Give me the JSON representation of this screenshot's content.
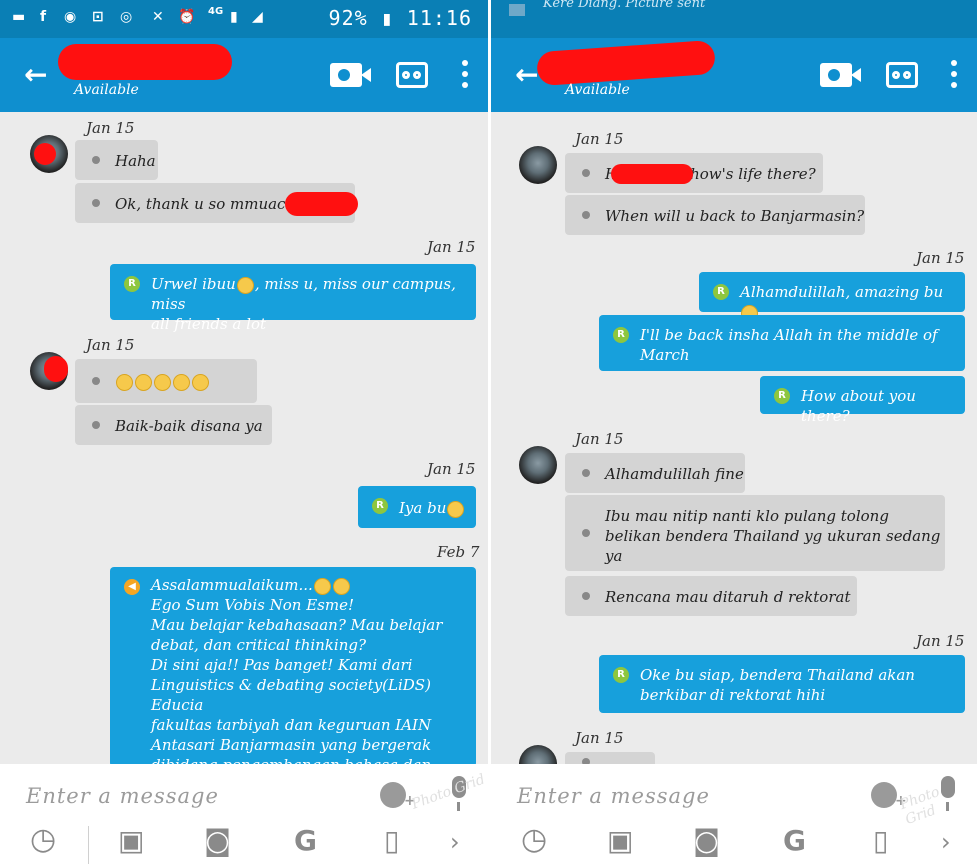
{
  "left": {
    "status_bar": {
      "battery": "92%",
      "time": "11:16",
      "network": "4G"
    },
    "contact_status": "Available",
    "messages": [
      {
        "type": "date",
        "text": "Jan 15"
      },
      {
        "type": "in",
        "text": "Haha"
      },
      {
        "type": "in",
        "text": "Ok, thank u so mmuach"
      },
      {
        "type": "date",
        "text": "Jan 15"
      },
      {
        "type": "out",
        "line1": "Urwel ibuu",
        "line1b": ", miss u, miss our campus, miss",
        "line2": "all friends a lot"
      },
      {
        "type": "date",
        "text": "Jan 15"
      },
      {
        "type": "in",
        "text": ""
      },
      {
        "type": "in",
        "text": "Baik-baik disana ya"
      },
      {
        "type": "date",
        "text": "Jan 15"
      },
      {
        "type": "out",
        "text": "Iya bu"
      },
      {
        "type": "date",
        "text": "Feb 7"
      },
      {
        "type": "broadcast",
        "lines": [
          "Assalammualaikum...",
          "Ego Sum Vobis Non Esme!",
          "Mau belajar kebahasaan? Mau belajar",
          "debat, dan critical thinking?",
          "Di sini aja!! Pas banget! Kami dari",
          "Linguistics & debating society(LiDS) Educia",
          "fakultas tarbiyah dan keguruan IAIN",
          "Antasari Banjarmasin yang bergerak",
          "dibidang pengembangan bahasa dan"
        ]
      }
    ]
  },
  "right": {
    "notification_preview": "Kere Diang. Picture sent",
    "contact_status": "Available",
    "messages": [
      {
        "type": "date",
        "text": "Jan 15"
      },
      {
        "type": "in",
        "pre": "H",
        "post": "how's life there?"
      },
      {
        "type": "in",
        "text": "When will u back to Banjarmasin?"
      },
      {
        "type": "date",
        "text": "Jan 15"
      },
      {
        "type": "out",
        "text": "Alhamdulillah, amazing bu"
      },
      {
        "type": "out",
        "line1": "I'll be back insha Allah in the middle of",
        "line2": "March"
      },
      {
        "type": "out",
        "text": "How about you there?"
      },
      {
        "type": "date",
        "text": "Jan 15"
      },
      {
        "type": "in",
        "text": "Alhamdulillah fine"
      },
      {
        "type": "in",
        "line1": "Ibu mau nitip nanti klo pulang tolong",
        "line2": "belikan bendera Thailand yg ukuran sedang",
        "line3": "ya"
      },
      {
        "type": "in",
        "text": "Rencana mau ditaruh d rektorat"
      },
      {
        "type": "date",
        "text": "Jan 15"
      },
      {
        "type": "out",
        "line1": "Oke bu siap, bendera Thailand akan",
        "line2": "berkibar di rektorat hihi"
      },
      {
        "type": "date",
        "text": "Jan 15"
      }
    ]
  },
  "composer": {
    "placeholder": "Enter a message",
    "badge": "R",
    "watermark": "Photo Grid"
  },
  "colors": {
    "appbar": "#0f8fcf",
    "statusbar": "#0a7fb5",
    "out_bubble": "#17a0dc",
    "in_bubble": "#d4d4d4",
    "redaction": "#ff1010",
    "badge": "#8ec63f"
  }
}
